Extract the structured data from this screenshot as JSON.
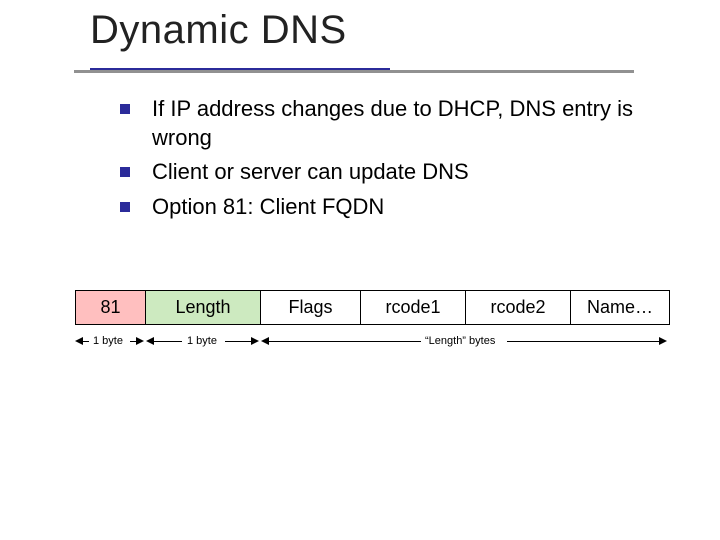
{
  "title": "Dynamic DNS",
  "bullets": [
    "If IP address changes due to DHCP, DNS entry is wrong",
    "Client or server can update DNS",
    "Option 81: Client FQDN"
  ],
  "packet": {
    "cells": [
      "81",
      "Length",
      "Flags",
      "rcode1",
      "rcode2",
      "Name…"
    ],
    "dim1": "1 byte",
    "dim2": "1 byte",
    "dim3": "“Length” bytes"
  }
}
